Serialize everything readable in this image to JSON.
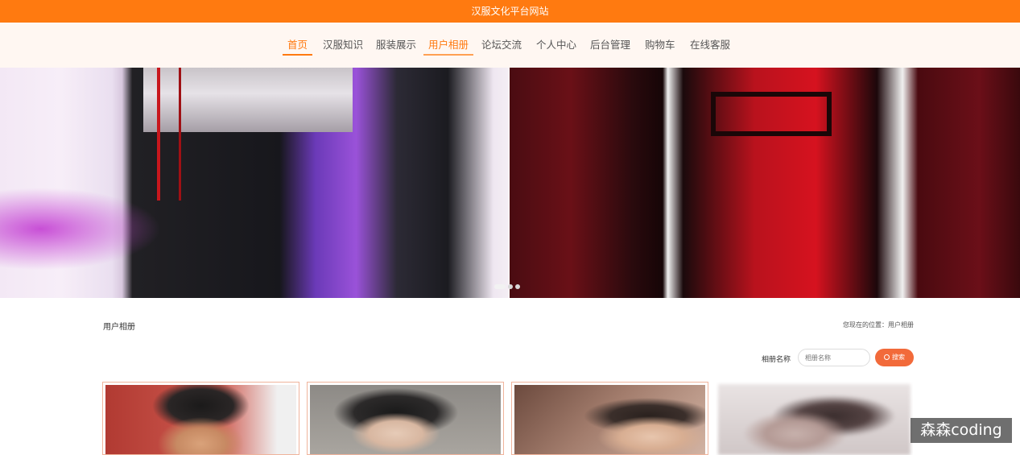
{
  "site": {
    "title": "汉服文化平台网站"
  },
  "nav": {
    "items": [
      {
        "label": "首页"
      },
      {
        "label": "汉服知识"
      },
      {
        "label": "服装展示"
      },
      {
        "label": "用户相册"
      },
      {
        "label": "论坛交流"
      },
      {
        "label": "个人中心"
      },
      {
        "label": "后台管理"
      },
      {
        "label": "购物车"
      },
      {
        "label": "在线客服"
      }
    ],
    "active": "首页",
    "hovered": "用户相册"
  },
  "carousel": {
    "total_slides": 3,
    "current_slide": 1
  },
  "page": {
    "section_title": "用户相册",
    "breadcrumb": "您现在的位置：用户相册"
  },
  "search": {
    "label": "相册名称",
    "placeholder": "相册名称",
    "button_label": "搜索"
  },
  "albums": {
    "visible_count": 4
  },
  "watermark": "森森coding",
  "colors": {
    "brand": "#ff7a10",
    "search_button": "#f26a3a",
    "nav_bg": "#fff7f2"
  }
}
